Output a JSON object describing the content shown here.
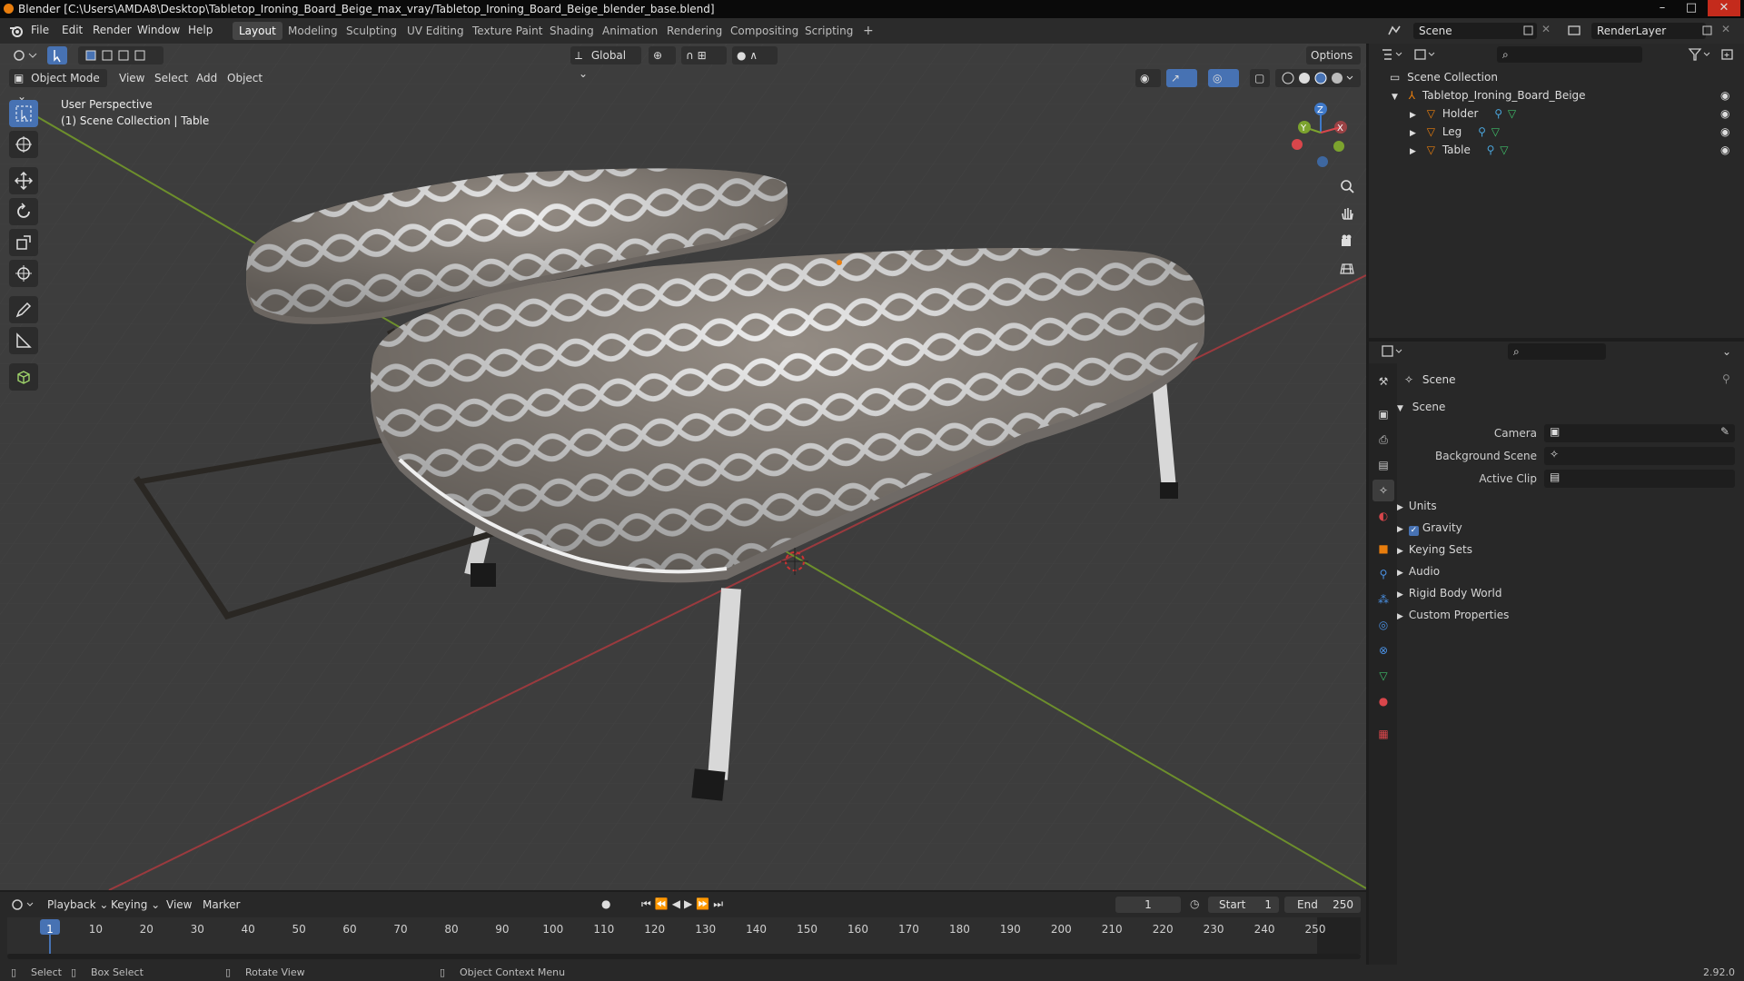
{
  "window": {
    "title": "Blender [C:\\Users\\AMDA8\\Desktop\\Tabletop_Ironing_Board_Beige_max_vray/Tabletop_Ironing_Board_Beige_blender_base.blend]",
    "minimize": "–",
    "maximize": "□",
    "close": "✕"
  },
  "menu": [
    "File",
    "Edit",
    "Render",
    "Window",
    "Help"
  ],
  "workspaces": [
    "Layout",
    "Modeling",
    "Sculpting",
    "UV Editing",
    "Texture Paint",
    "Shading",
    "Animation",
    "Rendering",
    "Compositing",
    "Scripting",
    "+"
  ],
  "topright": {
    "scene": "Scene",
    "renderlayer": "RenderLayer"
  },
  "viewport": {
    "transform_orientation": "Global",
    "options": "Options",
    "mode": "Object Mode",
    "header_menu": [
      "View",
      "Select",
      "Add",
      "Object"
    ],
    "info_line1": "User Perspective",
    "info_line2": "(1) Scene Collection | Table",
    "gizmo": {
      "x": "X",
      "y": "Y",
      "z": "Z"
    }
  },
  "outliner": {
    "root": "Scene Collection",
    "collection": "Tabletop_Ironing_Board_Beige",
    "items": [
      "Holder",
      "Leg",
      "Table"
    ]
  },
  "properties": {
    "context": "Scene",
    "section": "Scene",
    "fields": [
      {
        "label": "Camera"
      },
      {
        "label": "Background Scene"
      },
      {
        "label": "Active Clip"
      }
    ],
    "panels": [
      "Units",
      "Gravity",
      "Keying Sets",
      "Audio",
      "Rigid Body World",
      "Custom Properties"
    ]
  },
  "timeline": {
    "menus": [
      "Playback",
      "Keying",
      "View",
      "Marker"
    ],
    "current_frame": "1",
    "start_label": "Start",
    "start": "1",
    "end_label": "End",
    "end": "250",
    "ticks": [
      "1",
      "10",
      "20",
      "30",
      "40",
      "50",
      "60",
      "70",
      "80",
      "90",
      "100",
      "110",
      "120",
      "130",
      "140",
      "150",
      "160",
      "170",
      "180",
      "190",
      "200",
      "210",
      "220",
      "230",
      "240",
      "250"
    ]
  },
  "statusbar": {
    "select": "Select",
    "box_select": "Box Select",
    "rotate": "Rotate View",
    "context_menu": "Object Context Menu",
    "version": "2.92.0"
  },
  "colors": {
    "accent": "#4772b3",
    "orange": "#e87d0d",
    "x_axis": "#d9464b",
    "y_axis": "#7ca32e",
    "z_axis": "#3f79c9"
  }
}
